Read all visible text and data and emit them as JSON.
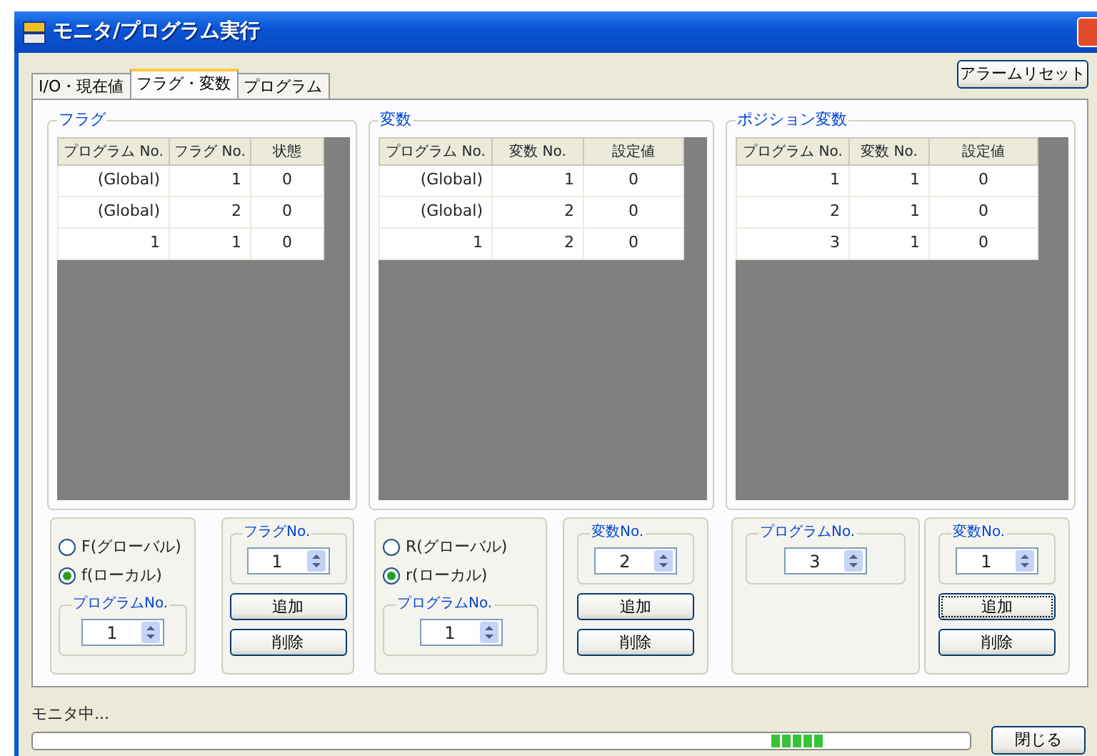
{
  "window": {
    "title": "モニタ/プログラム実行"
  },
  "alarm_reset_button": "アラームリセット",
  "tabs": [
    {
      "label": "I/O・現在値",
      "selected": false
    },
    {
      "label": "フラグ・変数",
      "selected": true
    },
    {
      "label": "プログラム",
      "selected": false
    }
  ],
  "sections": [
    {
      "title": "フラグ",
      "columns": [
        "プログラム No.",
        "フラグ No.",
        "状態"
      ],
      "rows": [
        [
          "(Global)",
          "1",
          "0"
        ],
        [
          "(Global)",
          "2",
          "0"
        ],
        [
          "1",
          "1",
          "0"
        ]
      ],
      "controls": [
        {
          "kind": "scope",
          "radios": [
            {
              "label": "F(グローバル)",
              "selected": false
            },
            {
              "label": "f(ローカル)",
              "selected": true
            }
          ],
          "spinner": {
            "label": "プログラムNo.",
            "value": "1"
          }
        },
        {
          "kind": "number_actions",
          "spinner": {
            "label": "フラグNo.",
            "value": "1"
          },
          "add_button": {
            "label": "追加",
            "focused": false
          },
          "delete_button": "削除"
        }
      ]
    },
    {
      "title": "変数",
      "columns": [
        "プログラム No.",
        "変数 No.",
        "設定値"
      ],
      "rows": [
        [
          "(Global)",
          "1",
          "0"
        ],
        [
          "(Global)",
          "2",
          "0"
        ],
        [
          "1",
          "2",
          "0"
        ]
      ],
      "controls": [
        {
          "kind": "scope",
          "radios": [
            {
              "label": "R(グローバル)",
              "selected": false
            },
            {
              "label": "r(ローカル)",
              "selected": true
            }
          ],
          "spinner": {
            "label": "プログラムNo.",
            "value": "1"
          }
        },
        {
          "kind": "number_actions",
          "spinner": {
            "label": "変数No.",
            "value": "2"
          },
          "add_button": {
            "label": "追加",
            "focused": false
          },
          "delete_button": "削除"
        }
      ]
    },
    {
      "title": "ポジション変数",
      "columns": [
        "プログラム No.",
        "変数 No.",
        "設定値"
      ],
      "rows": [
        [
          "1",
          "1",
          "0"
        ],
        [
          "2",
          "1",
          "0"
        ],
        [
          "3",
          "1",
          "0"
        ]
      ],
      "controls": [
        {
          "kind": "number",
          "spinner": {
            "label": "プログラムNo.",
            "value": "3"
          }
        },
        {
          "kind": "number_actions",
          "spinner": {
            "label": "変数No.",
            "value": "1"
          },
          "add_button": {
            "label": "追加",
            "focused": true
          },
          "delete_button": "削除"
        }
      ]
    }
  ],
  "status_text": "モニタ中...",
  "progress_bar": {
    "level": 0.84
  },
  "close_button": "閉じる"
}
